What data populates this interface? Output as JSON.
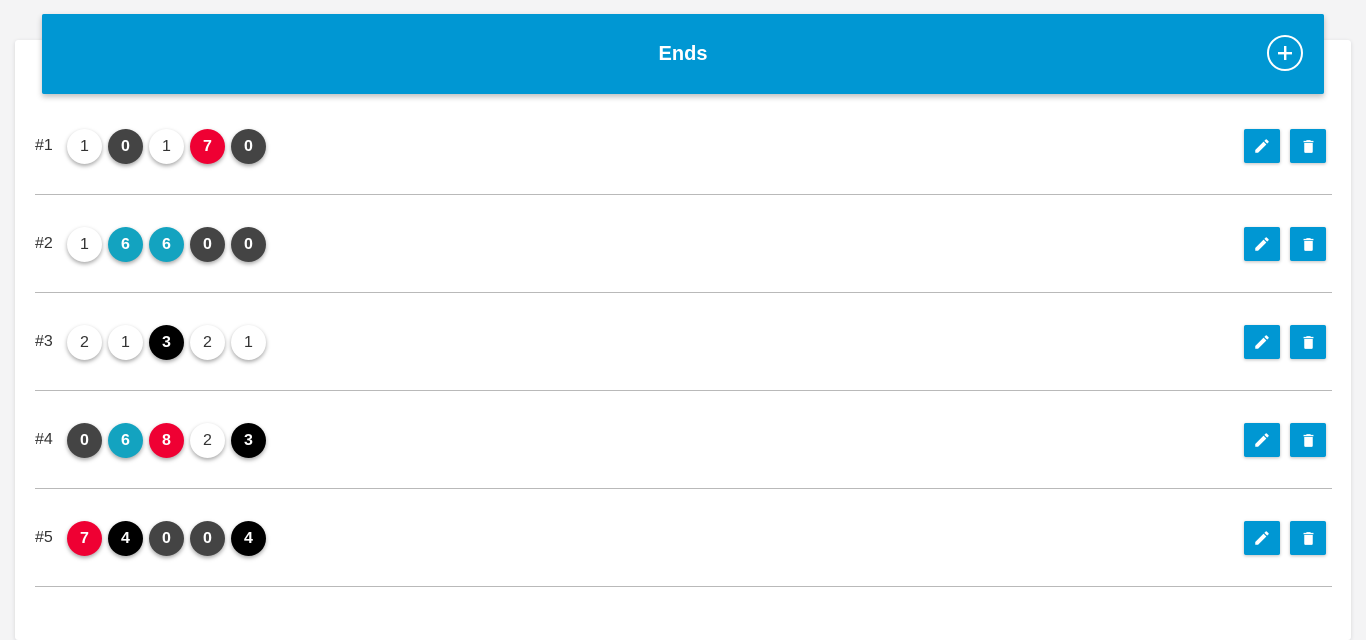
{
  "header": {
    "title": "Ends",
    "add_icon": "plus-circle-icon"
  },
  "colors": {
    "accent": "#0097d3",
    "white_arrow": "#ffffff",
    "dark_arrow": "#444444",
    "black_arrow": "#000000",
    "red_arrow": "#ef0033",
    "blue_arrow": "#13a3c0"
  },
  "ends": [
    {
      "label": "#1",
      "arrows": [
        {
          "v": "1",
          "c": "white"
        },
        {
          "v": "0",
          "c": "dark"
        },
        {
          "v": "1",
          "c": "white"
        },
        {
          "v": "7",
          "c": "red"
        },
        {
          "v": "0",
          "c": "dark"
        }
      ]
    },
    {
      "label": "#2",
      "arrows": [
        {
          "v": "1",
          "c": "white"
        },
        {
          "v": "6",
          "c": "blue"
        },
        {
          "v": "6",
          "c": "blue"
        },
        {
          "v": "0",
          "c": "dark"
        },
        {
          "v": "0",
          "c": "dark"
        }
      ]
    },
    {
      "label": "#3",
      "arrows": [
        {
          "v": "2",
          "c": "white"
        },
        {
          "v": "1",
          "c": "white"
        },
        {
          "v": "3",
          "c": "black"
        },
        {
          "v": "2",
          "c": "white"
        },
        {
          "v": "1",
          "c": "white"
        }
      ]
    },
    {
      "label": "#4",
      "arrows": [
        {
          "v": "0",
          "c": "dark"
        },
        {
          "v": "6",
          "c": "blue"
        },
        {
          "v": "8",
          "c": "red"
        },
        {
          "v": "2",
          "c": "white"
        },
        {
          "v": "3",
          "c": "black"
        }
      ]
    },
    {
      "label": "#5",
      "arrows": [
        {
          "v": "7",
          "c": "red"
        },
        {
          "v": "4",
          "c": "black"
        },
        {
          "v": "0",
          "c": "dark"
        },
        {
          "v": "0",
          "c": "dark"
        },
        {
          "v": "4",
          "c": "black"
        }
      ]
    }
  ],
  "row_actions": {
    "edit_icon": "pencil-icon",
    "delete_icon": "trash-icon"
  }
}
